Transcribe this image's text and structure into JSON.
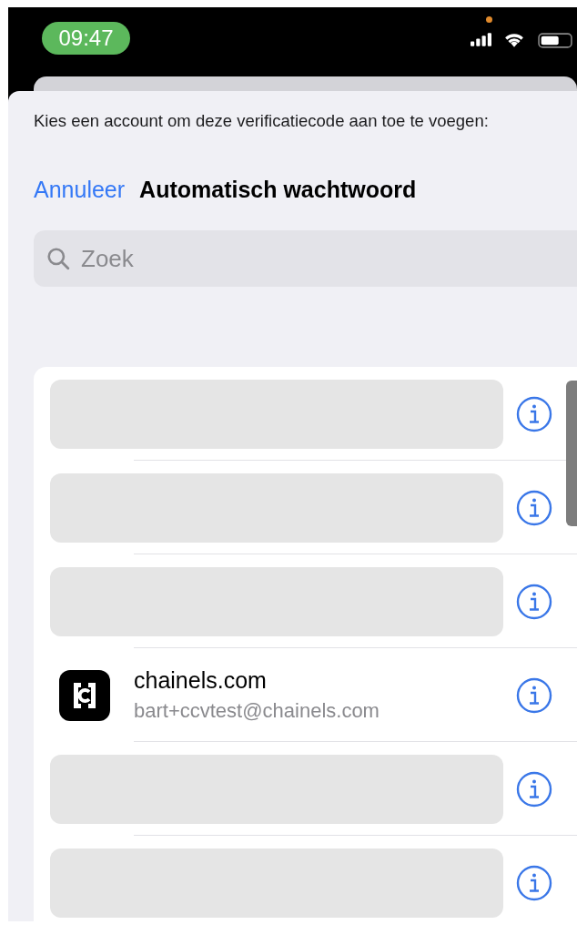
{
  "status_bar": {
    "time": "09:47",
    "recording_indicator": true
  },
  "sheet": {
    "prompt": "Kies een account om deze verificatiecode aan toe te voegen:",
    "cancel": "Annuleer",
    "title": "Automatisch wachtwoord",
    "search": {
      "placeholder": "Zoek"
    },
    "accounts": [
      {
        "kind": "redacted"
      },
      {
        "kind": "redacted"
      },
      {
        "kind": "redacted"
      },
      {
        "kind": "account",
        "site": "chainels.com",
        "username": "bart+ccvtest@chainels.com"
      },
      {
        "kind": "redacted"
      },
      {
        "kind": "redacted"
      }
    ]
  }
}
